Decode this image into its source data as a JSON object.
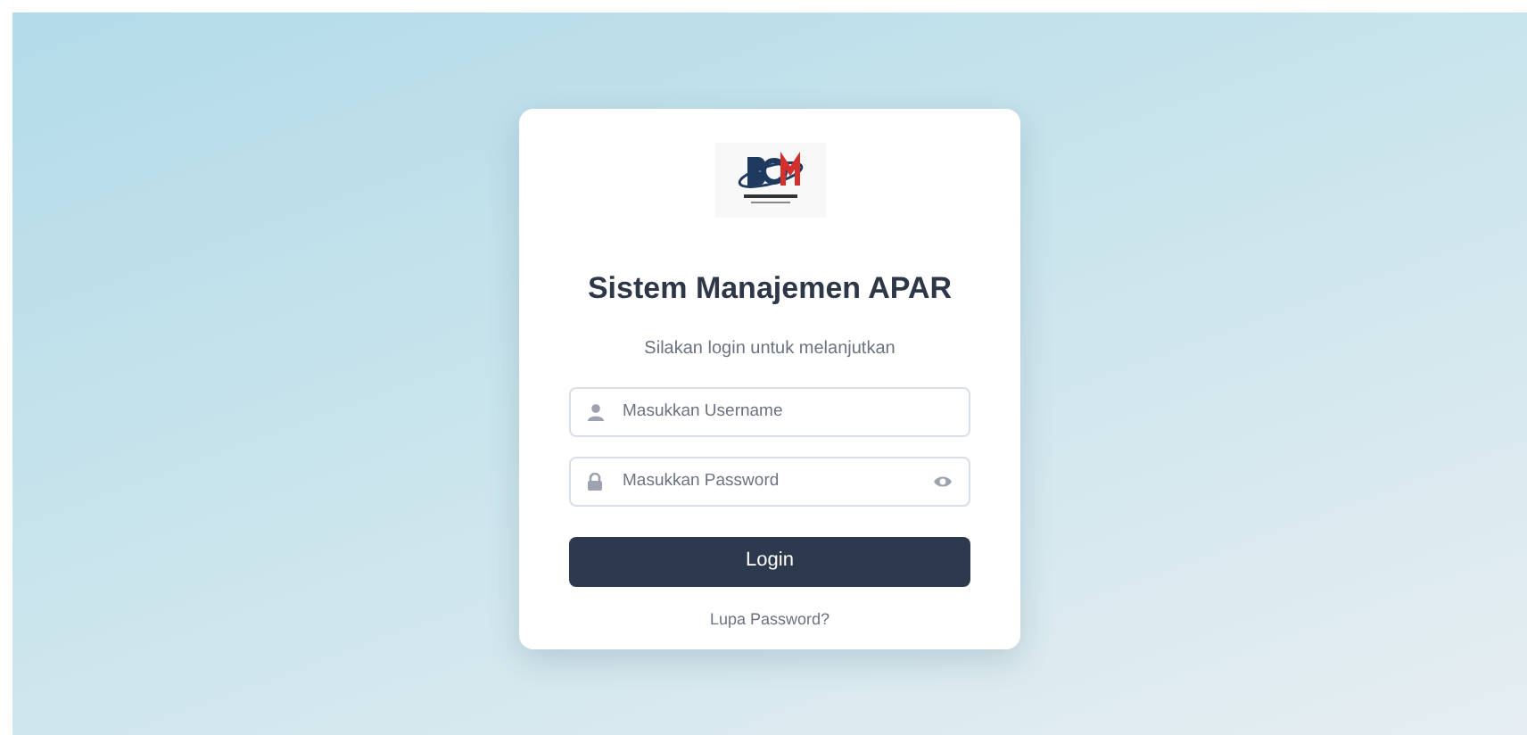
{
  "title": "Sistem Manajemen APAR",
  "subtitle": "Silakan login untuk melanjutkan",
  "fields": [
    {
      "kind": "username",
      "placeholder": "Masukkan Username"
    },
    {
      "kind": "password",
      "placeholder": "Masukkan Password"
    }
  ],
  "login_button": "Login",
  "forgot_link": "Lupa Password?"
}
